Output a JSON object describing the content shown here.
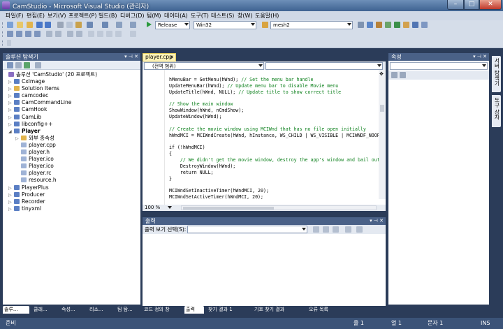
{
  "window": {
    "title": "CamStudio - Microsoft Visual Studio (관리자)"
  },
  "menu": [
    "파일(F)",
    "편집(E)",
    "보기(V)",
    "프로젝트(P)",
    "빌드(B)",
    "디버그(D)",
    "팀(M)",
    "데이터(A)",
    "도구(T)",
    "테스트(S)",
    "창(W)",
    "도움말(H)"
  ],
  "toolbar": {
    "config": "Release",
    "platform": "Win32",
    "find": "mesh2"
  },
  "solution_explorer": {
    "title": "솔루션 탐색기",
    "root": "솔루션 'CamStudio' (20 프로젝트)",
    "items": [
      {
        "label": "CxImage",
        "level": 1,
        "expander": "▷",
        "kind": "proj"
      },
      {
        "label": "Solution Items",
        "level": 1,
        "expander": "▷",
        "kind": "folder"
      },
      {
        "label": "camcodec",
        "level": 1,
        "expander": "▷",
        "kind": "proj"
      },
      {
        "label": "CamCommandLine",
        "level": 1,
        "expander": "▷",
        "kind": "proj"
      },
      {
        "label": "CamHook",
        "level": 1,
        "expander": "▷",
        "kind": "proj"
      },
      {
        "label": "CamLib",
        "level": 1,
        "expander": "▷",
        "kind": "proj"
      },
      {
        "label": "libconfig++",
        "level": 1,
        "expander": "▷",
        "kind": "proj"
      },
      {
        "label": "Player",
        "level": 1,
        "expander": "◢",
        "kind": "proj",
        "bold": true
      },
      {
        "label": "외부 종속성",
        "level": 2,
        "expander": "▷",
        "kind": "folder"
      },
      {
        "label": "player.cpp",
        "level": 2,
        "expander": "",
        "kind": "file"
      },
      {
        "label": "player.h",
        "level": 2,
        "expander": "",
        "kind": "file"
      },
      {
        "label": "Player.ico",
        "level": 2,
        "expander": "",
        "kind": "file"
      },
      {
        "label": "Player.ico",
        "level": 2,
        "expander": "",
        "kind": "file"
      },
      {
        "label": "player.rc",
        "level": 2,
        "expander": "",
        "kind": "file"
      },
      {
        "label": "resource.h",
        "level": 2,
        "expander": "",
        "kind": "file"
      },
      {
        "label": "PlayerPlus",
        "level": 1,
        "expander": "▷",
        "kind": "proj"
      },
      {
        "label": "Producer",
        "level": 1,
        "expander": "▷",
        "kind": "proj"
      },
      {
        "label": "Recorder",
        "level": 1,
        "expander": "▷",
        "kind": "proj"
      },
      {
        "label": "tinyxml",
        "level": 1,
        "expander": "▷",
        "kind": "proj"
      }
    ],
    "bottom_tabs": [
      "솔루...",
      "클래...",
      "속성...",
      "리소...",
      "팀 탐..."
    ]
  },
  "editor": {
    "tab": "player.cpp",
    "scope": "(전역 범위)",
    "zoom": "100 %",
    "lines": [
      {
        "code": "hMenuBar = GetMenu(hWnd); ",
        "comment": "// Set the menu bar handle"
      },
      {
        "code": "UpdateMenuBar(hWnd); ",
        "comment": "// Update menu bar to disable Movie menu"
      },
      {
        "code": "UpdateTitle(hWnd, NULL); ",
        "comment": "// Update title to show correct title"
      },
      {
        "code": "",
        "comment": ""
      },
      {
        "code": "",
        "comment": "// Show the main window"
      },
      {
        "code": "ShowWindow(hWnd, nCmdShow);",
        "comment": ""
      },
      {
        "code": "UpdateWindow(hWnd);",
        "comment": ""
      },
      {
        "code": "",
        "comment": ""
      },
      {
        "code": "",
        "comment": "// Create the movie window using MCIWnd that has no file open initially"
      },
      {
        "code": "hWndMCI = MCIWndCreate(hWnd, hInstance, WS_CHILD | WS_VISIBLE | MCIWNDF_NOOP",
        "comment": ""
      },
      {
        "code": "",
        "comment": ""
      },
      {
        "code": "if (!hWndMCI)",
        "comment": ""
      },
      {
        "code": "{",
        "comment": ""
      },
      {
        "code": "    ",
        "comment": "// We didn't get the movie window, destroy the app's window and bail out"
      },
      {
        "code": "    DestroyWindow(hWnd);",
        "comment": ""
      },
      {
        "code": "    return NULL;",
        "comment": ""
      },
      {
        "code": "}",
        "comment": ""
      },
      {
        "code": "",
        "comment": ""
      },
      {
        "code": "MCIWndSetInactiveTimer(hWndMCI, 20);",
        "comment": ""
      },
      {
        "code": "MCIWndSetActiveTimer(hWndMCI, 20);",
        "comment": ""
      }
    ]
  },
  "output": {
    "title": "출력",
    "source_label": "출력 보기 선택(S):"
  },
  "bottom_tabs": [
    "코드 정의 창",
    "출력",
    "찾기 결과 1",
    "기호 찾기 결과",
    "오류 목록"
  ],
  "properties": {
    "title": "속성"
  },
  "side_tabs": [
    "서버 탐색기",
    "도구 상자"
  ],
  "status": {
    "ready": "준비",
    "line": "줄 1",
    "col": "열 1",
    "char": "문자 1",
    "mode": "INS"
  },
  "colors": {
    "frame": "#2b3c59",
    "panel_title": "#4a6187",
    "tab_active": "#fff4b8",
    "comment": "#0a7f1a"
  }
}
